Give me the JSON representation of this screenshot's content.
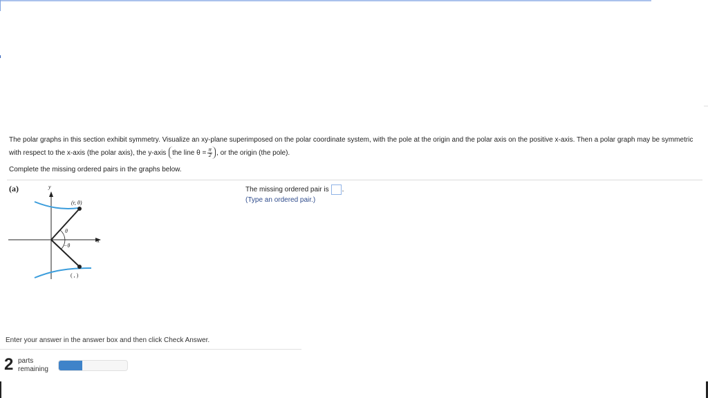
{
  "question": {
    "intro_part1": "The polar graphs in this section exhibit symmetry. Visualize an xy-plane superimposed on the polar coordinate system, with the pole at the origin and the polar axis on the positive x-axis. Then a polar graph may be symmetric with respect to the x-axis (the polar axis), the y-axis",
    "paren_text": "the line θ =",
    "frac_num": "π",
    "frac_den": "2",
    "intro_part2": ", or the origin (the pole).",
    "complete_text": "Complete the missing ordered pairs in the graphs below."
  },
  "part": {
    "label": "(a)"
  },
  "graph": {
    "y_axis_label": "y",
    "x_axis_label": "x",
    "point_label": "(r, θ)",
    "theta_label": "θ",
    "neg_theta_label": "−θ",
    "missing_point_label": "( , )",
    "curve_color": "#3b9ddc"
  },
  "answer": {
    "prompt": "The missing ordered pair is",
    "period": ".",
    "hint": "(Type an ordered pair.)",
    "value": ""
  },
  "footer": {
    "instruction": "Enter your answer in the answer box and then click Check Answer.",
    "parts_count": "2",
    "parts_word": "parts",
    "remaining_word": "remaining",
    "progress_fraction": 0.34
  },
  "colors": {
    "progress": "#3f83c9",
    "hint": "#2e4b8c"
  }
}
